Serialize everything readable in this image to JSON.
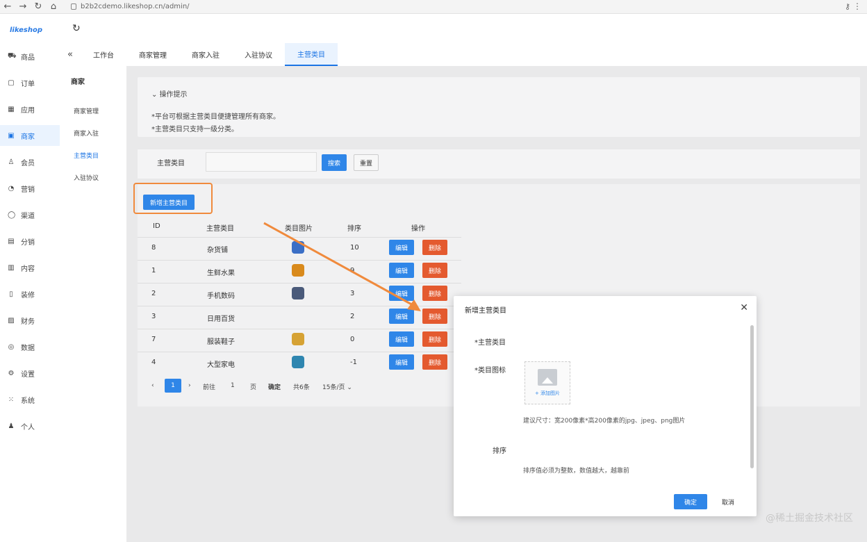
{
  "browser": {
    "url": "b2b2cdemo.likeshop.cn/admin/"
  },
  "logo": "likeshop",
  "sidebar": {
    "items": [
      {
        "label": "商品",
        "icon": "cart-icon"
      },
      {
        "label": "订单",
        "icon": "order-icon"
      },
      {
        "label": "应用",
        "icon": "app-icon"
      },
      {
        "label": "商家",
        "icon": "shop-icon"
      },
      {
        "label": "会员",
        "icon": "member-icon"
      },
      {
        "label": "营销",
        "icon": "marketing-icon"
      },
      {
        "label": "渠道",
        "icon": "channel-icon"
      },
      {
        "label": "分销",
        "icon": "distribution-icon"
      },
      {
        "label": "内容",
        "icon": "content-icon"
      },
      {
        "label": "装修",
        "icon": "decorate-icon"
      },
      {
        "label": "财务",
        "icon": "finance-icon"
      },
      {
        "label": "数据",
        "icon": "data-icon"
      },
      {
        "label": "设置",
        "icon": "settings-icon"
      },
      {
        "label": "系统",
        "icon": "system-icon"
      },
      {
        "label": "个人",
        "icon": "person-icon"
      }
    ]
  },
  "tabs": [
    "工作台",
    "商家管理",
    "商家入驻",
    "入驻协议",
    "主营类目"
  ],
  "subsidebar": {
    "title": "商家",
    "items": [
      "商家管理",
      "商家入驻",
      "主营类目",
      "入驻协议"
    ]
  },
  "tips": {
    "header": "操作提示",
    "lines": [
      "*平台可根据主营类目便捷管理所有商家。",
      "*主营类目只支持一级分类。"
    ]
  },
  "search": {
    "label": "主营类目",
    "search_button": "搜索",
    "reset_button": "重置"
  },
  "add_button": "新增主营类目",
  "table": {
    "headers": [
      "ID",
      "主营类目",
      "类目图片",
      "排序",
      "操作"
    ],
    "rows": [
      {
        "id": "8",
        "name": "杂货铺",
        "sort": "10"
      },
      {
        "id": "1",
        "name": "生鲜水果",
        "sort": "9"
      },
      {
        "id": "2",
        "name": "手机数码",
        "sort": "3"
      },
      {
        "id": "3",
        "name": "日用百货",
        "sort": "2"
      },
      {
        "id": "7",
        "name": "服装鞋子",
        "sort": "0"
      },
      {
        "id": "4",
        "name": "大型家电",
        "sort": "-1"
      }
    ],
    "edit_label": "编辑",
    "delete_label": "删除"
  },
  "pager": {
    "current": "1",
    "goto": "前往",
    "page": "1",
    "page_unit": "页",
    "confirm": "确定",
    "total": "共6条",
    "page_size": "15条/页"
  },
  "modal": {
    "title": "新增主营类目",
    "name_label": "*主营类目",
    "image_label": "*类目图标",
    "upload_text": "+ 添加图片",
    "image_hint": "建议尺寸：宽200像素*高200像素的jpg、jpeg、png图片",
    "sort_label": "排序",
    "sort_hint": "排序值必须为整数，数值越大，越靠前",
    "confirm": "确定",
    "cancel": "取消"
  },
  "watermark": "@稀土掘金技术社区",
  "colors": {
    "primary": "#2f86e8",
    "danger": "#e45a2f",
    "annotation": "#f08a3c"
  }
}
